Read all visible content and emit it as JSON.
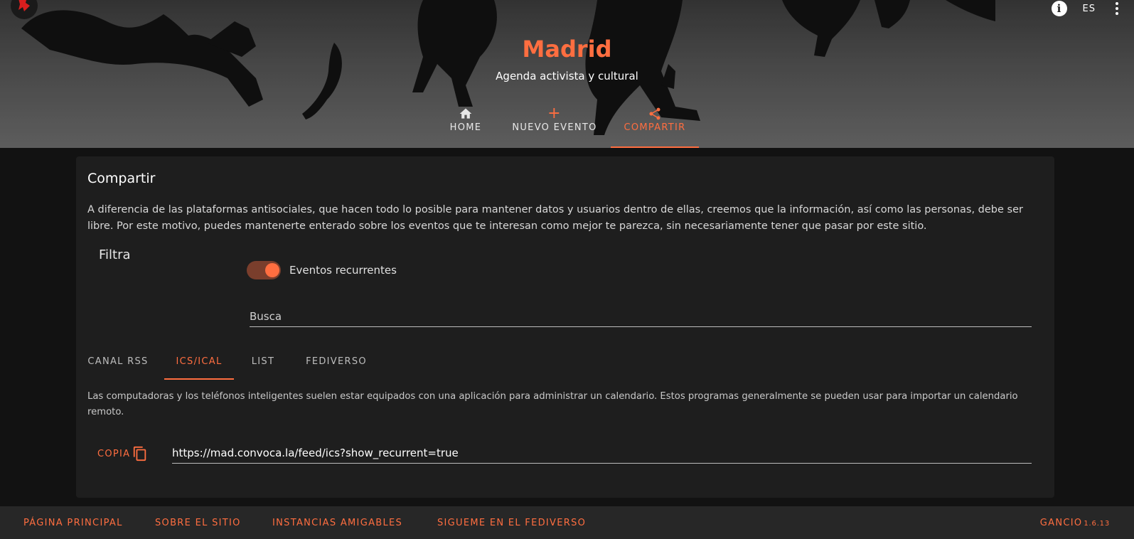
{
  "header": {
    "title": "Madrid",
    "subtitle": "Agenda activista y cultural",
    "language": "ES",
    "icons": {
      "info": "info-icon",
      "menu": "more-vertical-icon",
      "logo": "gancio-logo"
    }
  },
  "nav": {
    "tabs": [
      {
        "label": "HOME",
        "icon": "home-icon",
        "active": false
      },
      {
        "label": "NUEVO EVENTO",
        "icon": "plus-icon",
        "active": false
      },
      {
        "label": "COMPARTIR",
        "icon": "share-icon",
        "active": true
      }
    ]
  },
  "share": {
    "title": "Compartir",
    "description": "A diferencia de las plataformas antisociales, que hacen todo lo posible para mantener datos y usuarios dentro de ellas, creemos que la información, así como las personas, debe ser libre. Por este motivo, puedes mantenerte enterado sobre los eventos que te interesan como mejor te parezca, sin necesariamente tener que pasar por este sitio.",
    "filter_label": "Filtra",
    "recurrent_toggle": {
      "label": "Eventos recurrentes",
      "checked": true
    },
    "search": {
      "placeholder": "Busca",
      "value": ""
    },
    "tabs": [
      {
        "label": "CANAL RSS",
        "active": false
      },
      {
        "label": "ICS/ICAL",
        "active": true
      },
      {
        "label": "LIST",
        "active": false
      },
      {
        "label": "FEDIVERSO",
        "active": false
      }
    ],
    "tab_description": "Las computadoras y los teléfonos inteligentes suelen estar equipados con una aplicación para administrar un calendario. Estos programas generalmente se pueden usar para importar un calendario remoto.",
    "copy_label": "COPIA",
    "feed_url": "https://mad.convoca.la/feed/ics?show_recurrent=true"
  },
  "footer": {
    "links": [
      "PÁGINA PRINCIPAL",
      "SOBRE EL SITIO",
      "INSTANCIAS AMIGABLES",
      "SIGUEME EN EL FEDIVERSO"
    ],
    "brand": "GANCIO",
    "version": "1.6.13"
  },
  "colors": {
    "accent": "#ff6e40",
    "background": "#121212",
    "card": "#1e1e1e",
    "footer": "#272727"
  }
}
